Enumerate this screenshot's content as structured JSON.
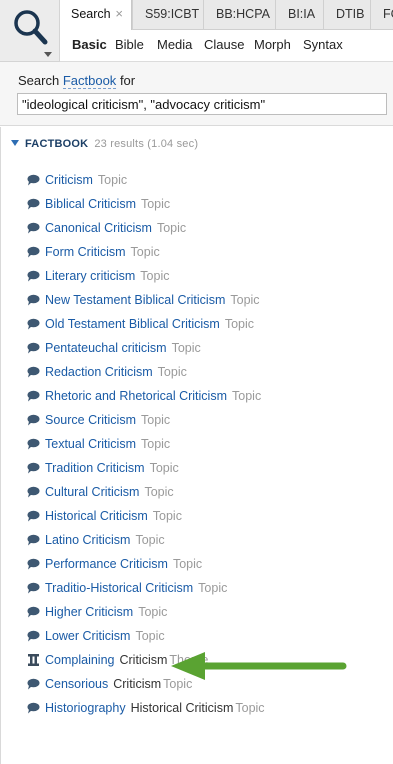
{
  "tabs": [
    {
      "label": "Search",
      "close": "×"
    },
    {
      "label": "S59:ICBT"
    },
    {
      "label": "BB:HCPA"
    },
    {
      "label": "BI:IA"
    },
    {
      "label": "DTIB"
    },
    {
      "label": "FC"
    }
  ],
  "subtabs": [
    "Basic",
    "Bible",
    "Media",
    "Clause",
    "Morph",
    "Syntax"
  ],
  "search": {
    "prefix": "Search",
    "resource": "Factbook",
    "suffix": "for",
    "query": "\"ideological criticism\", \"advocacy criticism\""
  },
  "group": {
    "name": "FACTBOOK",
    "count": "23 results (1.04 sec)"
  },
  "results": [
    {
      "title": "Criticism",
      "type": "Topic",
      "icon": "speech-bubble-icon"
    },
    {
      "title": "Biblical Criticism",
      "type": "Topic",
      "icon": "speech-bubble-icon"
    },
    {
      "title": "Canonical Criticism",
      "type": "Topic",
      "icon": "speech-bubble-icon"
    },
    {
      "title": "Form Criticism",
      "type": "Topic",
      "icon": "speech-bubble-icon"
    },
    {
      "title": "Literary criticism",
      "type": "Topic",
      "icon": "speech-bubble-icon"
    },
    {
      "title": "New Testament Biblical Criticism",
      "type": "Topic",
      "icon": "speech-bubble-icon"
    },
    {
      "title": "Old Testament Biblical Criticism",
      "type": "Topic",
      "icon": "speech-bubble-icon"
    },
    {
      "title": "Pentateuchal criticism",
      "type": "Topic",
      "icon": "speech-bubble-icon"
    },
    {
      "title": "Redaction Criticism",
      "type": "Topic",
      "icon": "speech-bubble-icon"
    },
    {
      "title": "Rhetoric and Rhetorical Criticism",
      "type": "Topic",
      "icon": "speech-bubble-icon"
    },
    {
      "title": "Source Criticism",
      "type": "Topic",
      "icon": "speech-bubble-icon"
    },
    {
      "title": "Textual Criticism",
      "type": "Topic",
      "icon": "speech-bubble-icon"
    },
    {
      "title": "Tradition Criticism",
      "type": "Topic",
      "icon": "speech-bubble-icon"
    },
    {
      "title": "Cultural Criticism",
      "type": "Topic",
      "icon": "speech-bubble-icon"
    },
    {
      "title": "Historical Criticism",
      "type": "Topic",
      "icon": "speech-bubble-icon"
    },
    {
      "title": "Latino Criticism",
      "type": "Topic",
      "icon": "speech-bubble-icon"
    },
    {
      "title": "Performance Criticism",
      "type": "Topic",
      "icon": "speech-bubble-icon"
    },
    {
      "title": "Traditio-Historical Criticism",
      "type": "Topic",
      "icon": "speech-bubble-icon"
    },
    {
      "title": "Higher Criticism",
      "type": "Topic",
      "icon": "speech-bubble-icon"
    },
    {
      "title": "Lower Criticism",
      "type": "Topic",
      "icon": "speech-bubble-icon"
    },
    {
      "title": "Complaining",
      "context": "Criticism",
      "type": "Theme",
      "icon": "theme-pillar-icon"
    },
    {
      "title": "Censorious",
      "context": "Criticism",
      "type": "Topic",
      "icon": "speech-bubble-icon"
    },
    {
      "title": "Historiography",
      "context": "Historical Criticism",
      "type": "Topic",
      "icon": "speech-bubble-icon"
    }
  ],
  "colors": {
    "link": "#1a5ba6",
    "arrow": "#5aa332"
  }
}
